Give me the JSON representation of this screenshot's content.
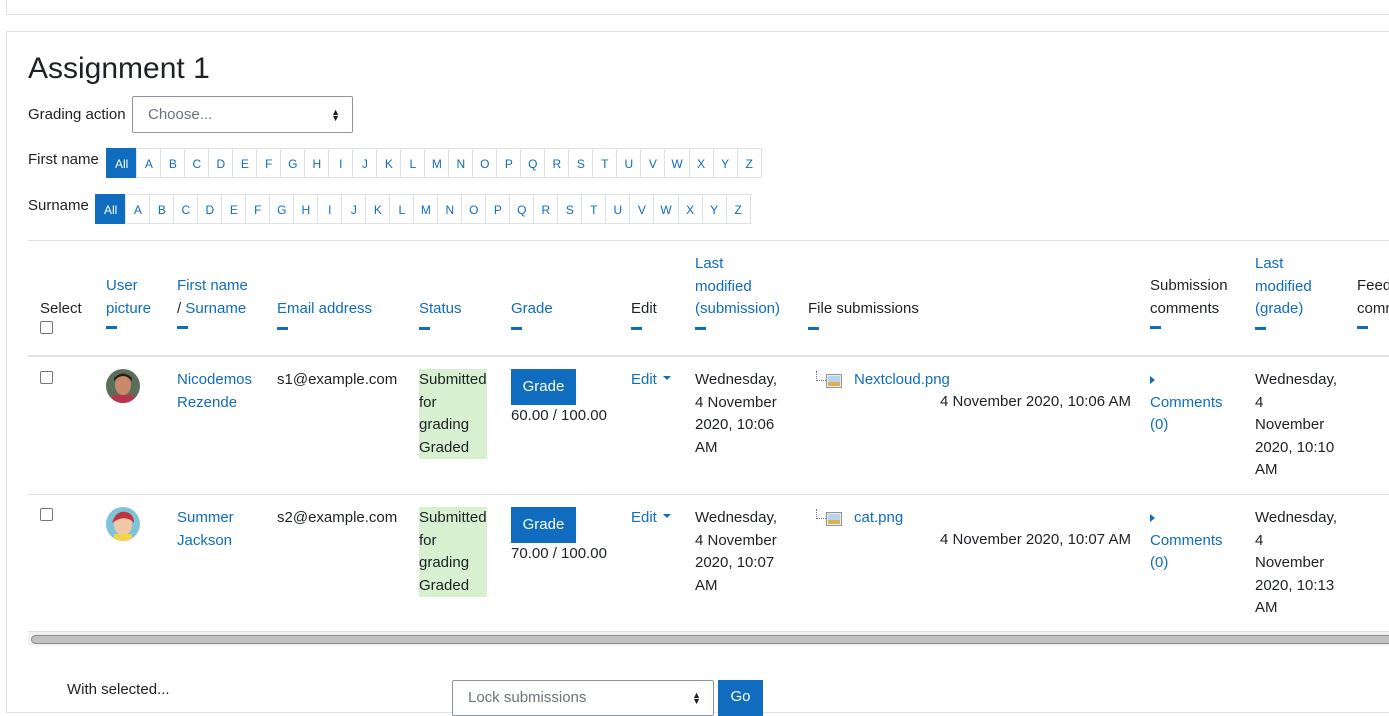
{
  "title": "Assignment 1",
  "grading_action": {
    "label": "Grading action",
    "value": "Choose..."
  },
  "first_name_filter": {
    "label": "First name",
    "letters": [
      "All",
      "A",
      "B",
      "C",
      "D",
      "E",
      "F",
      "G",
      "H",
      "I",
      "J",
      "K",
      "L",
      "M",
      "N",
      "O",
      "P",
      "Q",
      "R",
      "S",
      "T",
      "U",
      "V",
      "W",
      "X",
      "Y",
      "Z"
    ]
  },
  "surname_filter": {
    "label": "Surname",
    "letters": [
      "All",
      "A",
      "B",
      "C",
      "D",
      "E",
      "F",
      "G",
      "H",
      "I",
      "J",
      "K",
      "L",
      "M",
      "N",
      "O",
      "P",
      "Q",
      "R",
      "S",
      "T",
      "U",
      "V",
      "W",
      "X",
      "Y",
      "Z"
    ]
  },
  "columns": {
    "select": "Select",
    "user_picture_1": "User",
    "user_picture_2": "picture",
    "first_name": "First name",
    "slash": "/ ",
    "surname": "Surname",
    "email": "Email address",
    "status": "Status",
    "grade": "Grade",
    "edit": "Edit",
    "lm_sub_1": "Last",
    "lm_sub_2": "modified",
    "lm_sub_3": "(submission)",
    "file_submissions": "File submissions",
    "sub_comments_1": "Submission",
    "sub_comments_2": "comments",
    "lm_grade_1": "Last",
    "lm_grade_2": "modified",
    "lm_grade_3": "(grade)",
    "feedback_1": "Feedback",
    "feedback_2": "comments"
  },
  "rows": [
    {
      "first": "Nicodemos",
      "last": "Rezende",
      "email": "s1@example.com",
      "status": [
        "Submitted",
        "for",
        "grading",
        "Graded"
      ],
      "grade_button": "Grade",
      "grade": "60.00 / 100.00",
      "edit": "Edit",
      "modified": [
        "Wednesday,",
        "4 November",
        "2020, 10:06",
        "AM"
      ],
      "file": "Nextcloud.png",
      "file_date": "4 November 2020, 10:06 AM",
      "comments": [
        "Comments",
        "(0)"
      ],
      "grade_modified": [
        "Wednesday,",
        "4",
        "November",
        "2020, 10:10",
        "AM"
      ]
    },
    {
      "first": "Summer",
      "last": "Jackson",
      "email": "s2@example.com",
      "status": [
        "Submitted",
        "for",
        "grading",
        "Graded"
      ],
      "grade_button": "Grade",
      "grade": "70.00 / 100.00",
      "edit": "Edit",
      "modified": [
        "Wednesday,",
        "4 November",
        "2020, 10:07",
        "AM"
      ],
      "file": "cat.png",
      "file_date": "4 November 2020, 10:07 AM",
      "comments": [
        "Comments",
        "(0)"
      ],
      "grade_modified": [
        "Wednesday,",
        "4",
        "November",
        "2020, 10:13",
        "AM"
      ]
    }
  ],
  "footer": {
    "with_selected": "With selected...",
    "action": "Lock submissions",
    "go": "Go"
  },
  "colors": {
    "primary": "#0f6cbf",
    "status_bg": "#d7f0d0"
  }
}
